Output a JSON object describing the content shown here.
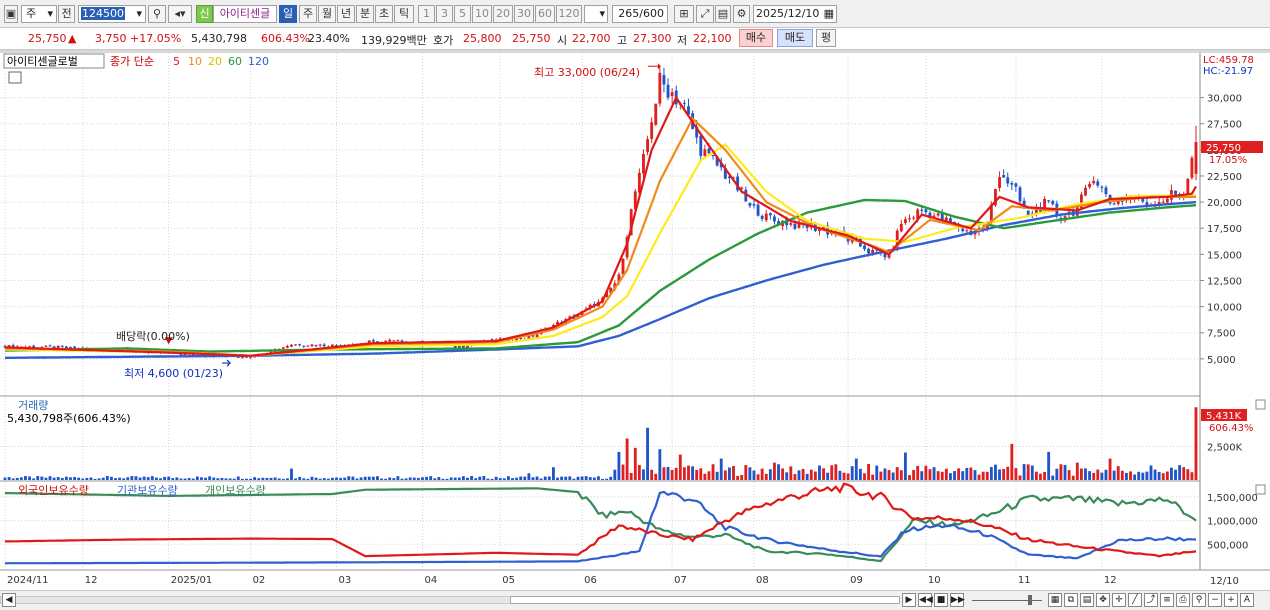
{
  "toolbar": {
    "market_label": "주",
    "prev_label": "전",
    "code": "124500",
    "new_label": "신",
    "name": "아이티센글",
    "period_tabs": [
      "일",
      "주",
      "월",
      "년",
      "분",
      "초",
      "틱"
    ],
    "active_period": "일",
    "intervals": [
      "1",
      "3",
      "5",
      "10",
      "20",
      "30",
      "60",
      "120"
    ],
    "count": "265",
    "count_max": "/600",
    "date": "2025/12/10"
  },
  "quote": {
    "price": "25,750",
    "change": "3,750",
    "change_pct": "+17.05%",
    "volume": "5,430,798",
    "volume_ratio": "606.43%",
    "turnover": "23.40%",
    "amount": "139,929백만",
    "hoga_label": "호가",
    "ask": "25,800",
    "bid": "25,750",
    "open_label": "시",
    "open": "22,700",
    "high_label": "고",
    "high": "27,300",
    "low_label": "저",
    "low": "22,100",
    "buy_label": "매수",
    "sell_label": "매도",
    "eval_label": "평"
  },
  "price_panel": {
    "title": "아이티센글로벌",
    "ma_label": "종가 단순",
    "mas": [
      "5",
      "10",
      "20",
      "60",
      "120"
    ],
    "lc": "LC:459.78",
    "hc": "HC:-21.97",
    "last_price": "25,750",
    "last_pct": "17.05%",
    "high_note": "최고 33,000 (06/24)",
    "low_note": "최저 4,600 (01/23)",
    "div_note": "배당락(0.00%)"
  },
  "volume_panel": {
    "title": "거래량",
    "value": "5,430,798주(606.43%)",
    "last": "5,431K",
    "last_pct": "606.43%"
  },
  "holding_panel": {
    "labels": [
      "외국인보유수량",
      "기관보유수량",
      "개인보유수량"
    ]
  },
  "chart_data": {
    "type": "line",
    "title": "아이티센글로벌",
    "ylim": [
      2500,
      33500
    ],
    "price_ticks": [
      5000,
      7500,
      10000,
      12500,
      15000,
      17500,
      20000,
      22500,
      25000,
      27500,
      30000
    ],
    "price_tick_labels": [
      "5,000",
      "7,500",
      "10,000",
      "12,500",
      "15,000",
      "17,500",
      "20,000",
      "22,500",
      "25,000",
      "27,500",
      "30,000"
    ],
    "x_labels": [
      "2024/11",
      "12",
      "2025/01",
      "02",
      "03",
      "04",
      "05",
      "06",
      "07",
      "08",
      "09",
      "10",
      "11",
      "12"
    ],
    "last_date": "12/10",
    "close": [
      [
        0,
        6200
      ],
      [
        18,
        6000
      ],
      [
        30,
        5800
      ],
      [
        45,
        5400
      ],
      [
        50,
        5300
      ],
      [
        58,
        5200
      ],
      [
        62,
        5400
      ],
      [
        70,
        6400
      ],
      [
        80,
        6300
      ],
      [
        95,
        6700
      ],
      [
        110,
        6200
      ],
      [
        120,
        6800
      ],
      [
        128,
        7000
      ],
      [
        134,
        8200
      ],
      [
        140,
        9200
      ],
      [
        146,
        10600
      ],
      [
        150,
        12800
      ],
      [
        152,
        17000
      ],
      [
        154,
        21000
      ],
      [
        156,
        24000
      ],
      [
        158,
        28000
      ],
      [
        160,
        31500
      ],
      [
        163,
        30500
      ],
      [
        166,
        29000
      ],
      [
        170,
        25000
      ],
      [
        174,
        23500
      ],
      [
        178,
        22000
      ],
      [
        182,
        19500
      ],
      [
        188,
        18200
      ],
      [
        194,
        17800
      ],
      [
        200,
        17500
      ],
      [
        206,
        16500
      ],
      [
        212,
        15200
      ],
      [
        216,
        14800
      ],
      [
        219,
        18000
      ],
      [
        224,
        19200
      ],
      [
        230,
        18200
      ],
      [
        236,
        17000
      ],
      [
        240,
        17800
      ],
      [
        243,
        23000
      ],
      [
        246,
        21500
      ],
      [
        250,
        18500
      ],
      [
        254,
        20000
      ],
      [
        258,
        18500
      ],
      [
        262,
        19500
      ],
      [
        266,
        22500
      ],
      [
        270,
        20000
      ],
      [
        276,
        20500
      ],
      [
        280,
        19800
      ],
      [
        284,
        20500
      ],
      [
        288,
        20800
      ],
      [
        291,
        25750
      ]
    ],
    "ma5": [
      [
        0,
        6100
      ],
      [
        40,
        5600
      ],
      [
        60,
        5300
      ],
      [
        90,
        6500
      ],
      [
        120,
        6700
      ],
      [
        134,
        8000
      ],
      [
        146,
        10500
      ],
      [
        152,
        16000
      ],
      [
        158,
        25000
      ],
      [
        164,
        30000
      ],
      [
        170,
        26500
      ],
      [
        180,
        21000
      ],
      [
        192,
        18200
      ],
      [
        206,
        16800
      ],
      [
        216,
        15000
      ],
      [
        224,
        18800
      ],
      [
        236,
        17500
      ],
      [
        243,
        20500
      ],
      [
        250,
        19500
      ],
      [
        262,
        19200
      ],
      [
        270,
        20300
      ],
      [
        284,
        20500
      ],
      [
        290,
        20800
      ],
      [
        291,
        21500
      ]
    ],
    "ma10": [
      [
        0,
        6000
      ],
      [
        40,
        5700
      ],
      [
        60,
        5300
      ],
      [
        90,
        6400
      ],
      [
        120,
        6600
      ],
      [
        134,
        7800
      ],
      [
        146,
        10000
      ],
      [
        152,
        13500
      ],
      [
        160,
        22000
      ],
      [
        168,
        28000
      ],
      [
        176,
        25000
      ],
      [
        186,
        20000
      ],
      [
        198,
        17600
      ],
      [
        212,
        15800
      ],
      [
        216,
        15200
      ],
      [
        226,
        18300
      ],
      [
        238,
        17300
      ],
      [
        246,
        19600
      ],
      [
        256,
        19200
      ],
      [
        268,
        20000
      ],
      [
        280,
        20500
      ],
      [
        291,
        20500
      ]
    ],
    "ma20": [
      [
        0,
        5900
      ],
      [
        45,
        5600
      ],
      [
        60,
        5300
      ],
      [
        90,
        6200
      ],
      [
        120,
        6400
      ],
      [
        134,
        7200
      ],
      [
        146,
        9000
      ],
      [
        152,
        11000
      ],
      [
        160,
        17000
      ],
      [
        170,
        24000
      ],
      [
        176,
        25500
      ],
      [
        186,
        21000
      ],
      [
        196,
        18200
      ],
      [
        210,
        16500
      ],
      [
        220,
        16200
      ],
      [
        232,
        17500
      ],
      [
        248,
        18500
      ],
      [
        262,
        19800
      ],
      [
        276,
        20600
      ],
      [
        291,
        20600
      ]
    ],
    "ma60": [
      [
        0,
        5800
      ],
      [
        30,
        6000
      ],
      [
        50,
        5700
      ],
      [
        80,
        5900
      ],
      [
        120,
        6000
      ],
      [
        140,
        6600
      ],
      [
        150,
        8200
      ],
      [
        160,
        11500
      ],
      [
        172,
        14500
      ],
      [
        184,
        17000
      ],
      [
        196,
        19000
      ],
      [
        210,
        20200
      ],
      [
        220,
        20100
      ],
      [
        232,
        18600
      ],
      [
        244,
        17500
      ],
      [
        256,
        18200
      ],
      [
        270,
        19000
      ],
      [
        284,
        19500
      ],
      [
        291,
        19700
      ]
    ],
    "ma120": [
      [
        0,
        5100
      ],
      [
        30,
        5200
      ],
      [
        60,
        5300
      ],
      [
        90,
        5500
      ],
      [
        120,
        5900
      ],
      [
        140,
        6200
      ],
      [
        150,
        7200
      ],
      [
        160,
        8800
      ],
      [
        172,
        10800
      ],
      [
        186,
        12500
      ],
      [
        200,
        14000
      ],
      [
        214,
        15200
      ],
      [
        230,
        16500
      ],
      [
        244,
        17800
      ],
      [
        258,
        18800
      ],
      [
        272,
        19400
      ],
      [
        284,
        19800
      ],
      [
        291,
        20000
      ]
    ],
    "volume_ticks": [
      2500
    ],
    "volume_tick_labels": [
      "2,500K"
    ],
    "volume_spikes": [
      [
        70,
        850
      ],
      [
        100,
        180
      ],
      [
        128,
        500
      ],
      [
        134,
        950
      ],
      [
        150,
        2100
      ],
      [
        152,
        3100
      ],
      [
        154,
        2400
      ],
      [
        157,
        3900
      ],
      [
        160,
        2300
      ],
      [
        165,
        1900
      ],
      [
        175,
        1600
      ],
      [
        188,
        1300
      ],
      [
        208,
        1600
      ],
      [
        220,
        2050
      ],
      [
        246,
        2700
      ],
      [
        255,
        2100
      ],
      [
        262,
        1300
      ],
      [
        270,
        1600
      ],
      [
        291,
        5431
      ]
    ],
    "holding_ticks": [
      500000,
      1000000,
      1500000
    ],
    "holding_tick_labels": [
      "500,000",
      "1,000,000",
      "1,500,000"
    ],
    "foreign": [
      [
        0,
        560000
      ],
      [
        30,
        600000
      ],
      [
        60,
        620000
      ],
      [
        80,
        610000
      ],
      [
        88,
        250000
      ],
      [
        120,
        320000
      ],
      [
        140,
        280000
      ],
      [
        150,
        900000
      ],
      [
        160,
        700000
      ],
      [
        168,
        600000
      ],
      [
        176,
        1000000
      ],
      [
        184,
        1300000
      ],
      [
        192,
        1500000
      ],
      [
        204,
        1700000
      ],
      [
        214,
        1500000
      ],
      [
        222,
        1050000
      ],
      [
        232,
        1050000
      ],
      [
        240,
        900000
      ],
      [
        250,
        600000
      ],
      [
        262,
        450000
      ],
      [
        272,
        350000
      ],
      [
        282,
        250000
      ],
      [
        291,
        350000
      ]
    ],
    "institution": [
      [
        0,
        100000
      ],
      [
        50,
        110000
      ],
      [
        88,
        120000
      ],
      [
        140,
        140000
      ],
      [
        155,
        350000
      ],
      [
        160,
        1600000
      ],
      [
        168,
        1450000
      ],
      [
        176,
        850000
      ],
      [
        186,
        600000
      ],
      [
        200,
        400000
      ],
      [
        214,
        240000
      ],
      [
        220,
        800000
      ],
      [
        230,
        900000
      ],
      [
        240,
        700000
      ],
      [
        250,
        280000
      ],
      [
        262,
        200000
      ],
      [
        272,
        580000
      ],
      [
        284,
        620000
      ],
      [
        291,
        600000
      ]
    ],
    "individual": [
      [
        0,
        1580000
      ],
      [
        40,
        1520000
      ],
      [
        80,
        1560000
      ],
      [
        88,
        1650000
      ],
      [
        130,
        1680000
      ],
      [
        140,
        1600000
      ],
      [
        146,
        1100000
      ],
      [
        152,
        1200000
      ],
      [
        160,
        800000
      ],
      [
        168,
        650000
      ],
      [
        176,
        700000
      ],
      [
        186,
        350000
      ],
      [
        200,
        300000
      ],
      [
        214,
        150000
      ],
      [
        222,
        1000000
      ],
      [
        232,
        900000
      ],
      [
        240,
        1100000
      ],
      [
        250,
        1450000
      ],
      [
        262,
        1450000
      ],
      [
        272,
        1350000
      ],
      [
        284,
        1450000
      ],
      [
        291,
        1000000
      ]
    ]
  },
  "colors": {
    "up": "#e02020",
    "down": "#1f55c8",
    "ma5": "#e01818",
    "ma10": "#f08a1a",
    "ma20": "#ffeb1a",
    "ma60": "#2a9a3a",
    "ma120": "#2f5fd0",
    "foreign": "#e01818",
    "institution": "#2f5fd0",
    "individual": "#3a8a5a"
  }
}
